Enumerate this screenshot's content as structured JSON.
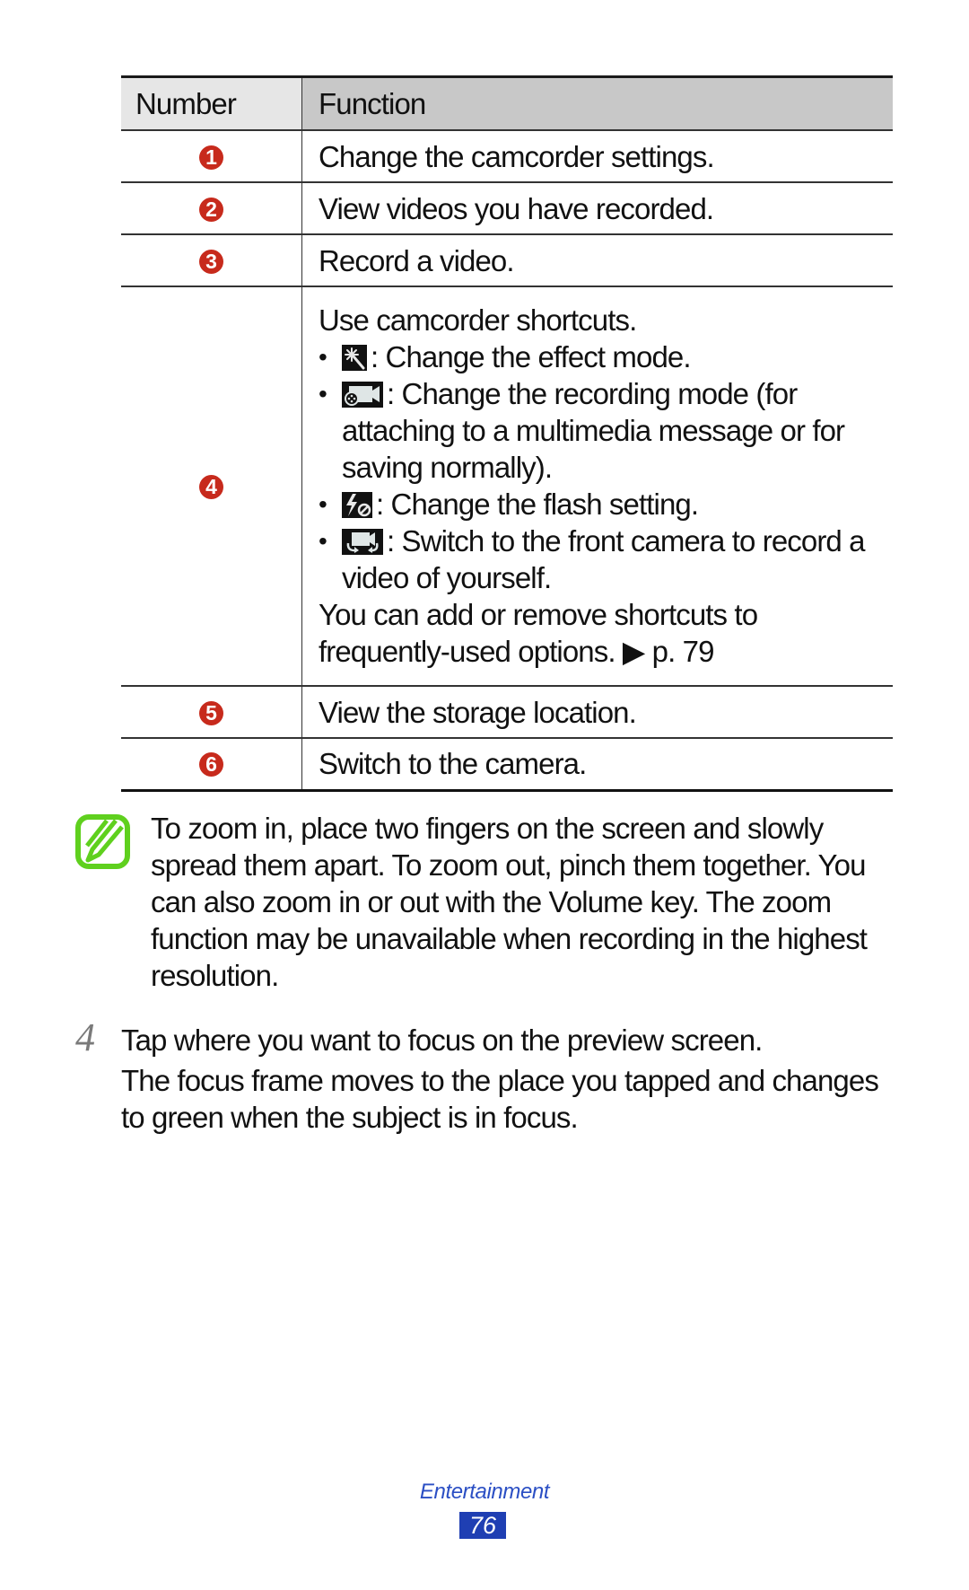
{
  "table": {
    "headers": {
      "number": "Number",
      "function": "Function"
    },
    "rows": [
      {
        "badge": "1",
        "text": "Change the camcorder settings."
      },
      {
        "badge": "2",
        "text": "View videos you have recorded."
      },
      {
        "badge": "3",
        "text": "Record a video."
      },
      {
        "badge": "4",
        "intro": "Use camcorder shortcuts.",
        "shortcuts": [
          {
            "icon": "effect-mode-icon",
            "text": ": Change the effect mode."
          },
          {
            "icon": "recording-mode-icon",
            "text": ": Change the recording mode (for attaching to a multimedia message or for saving normally)."
          },
          {
            "icon": "flash-off-icon",
            "text": ": Change the flash setting."
          },
          {
            "icon": "switch-camera-icon",
            "text": ": Switch to the front camera to record a video of yourself."
          }
        ],
        "outro": "You can add or remove shortcuts to frequently-used options. ▶ p. 79"
      },
      {
        "badge": "5",
        "text": "View the storage location."
      },
      {
        "badge": "6",
        "text": "Switch to the camera."
      }
    ],
    "badge_color": "#c72a1c"
  },
  "note": {
    "icon": "note-pencil-icon",
    "icon_color": "#5fd01e",
    "text": "To zoom in, place two fingers on the screen and slowly spread them apart. To zoom out, pinch them together. You can also zoom in or out with the Volume key. The zoom function may be unavailable when recording in the highest resolution."
  },
  "step": {
    "number": "4",
    "text": "Tap where you want to focus on the preview screen.",
    "sub": "The focus frame moves to the place you tapped and changes to green when the subject is in focus."
  },
  "footer": {
    "section": "Entertainment",
    "page": "76",
    "accent": "#1f3fb3"
  }
}
